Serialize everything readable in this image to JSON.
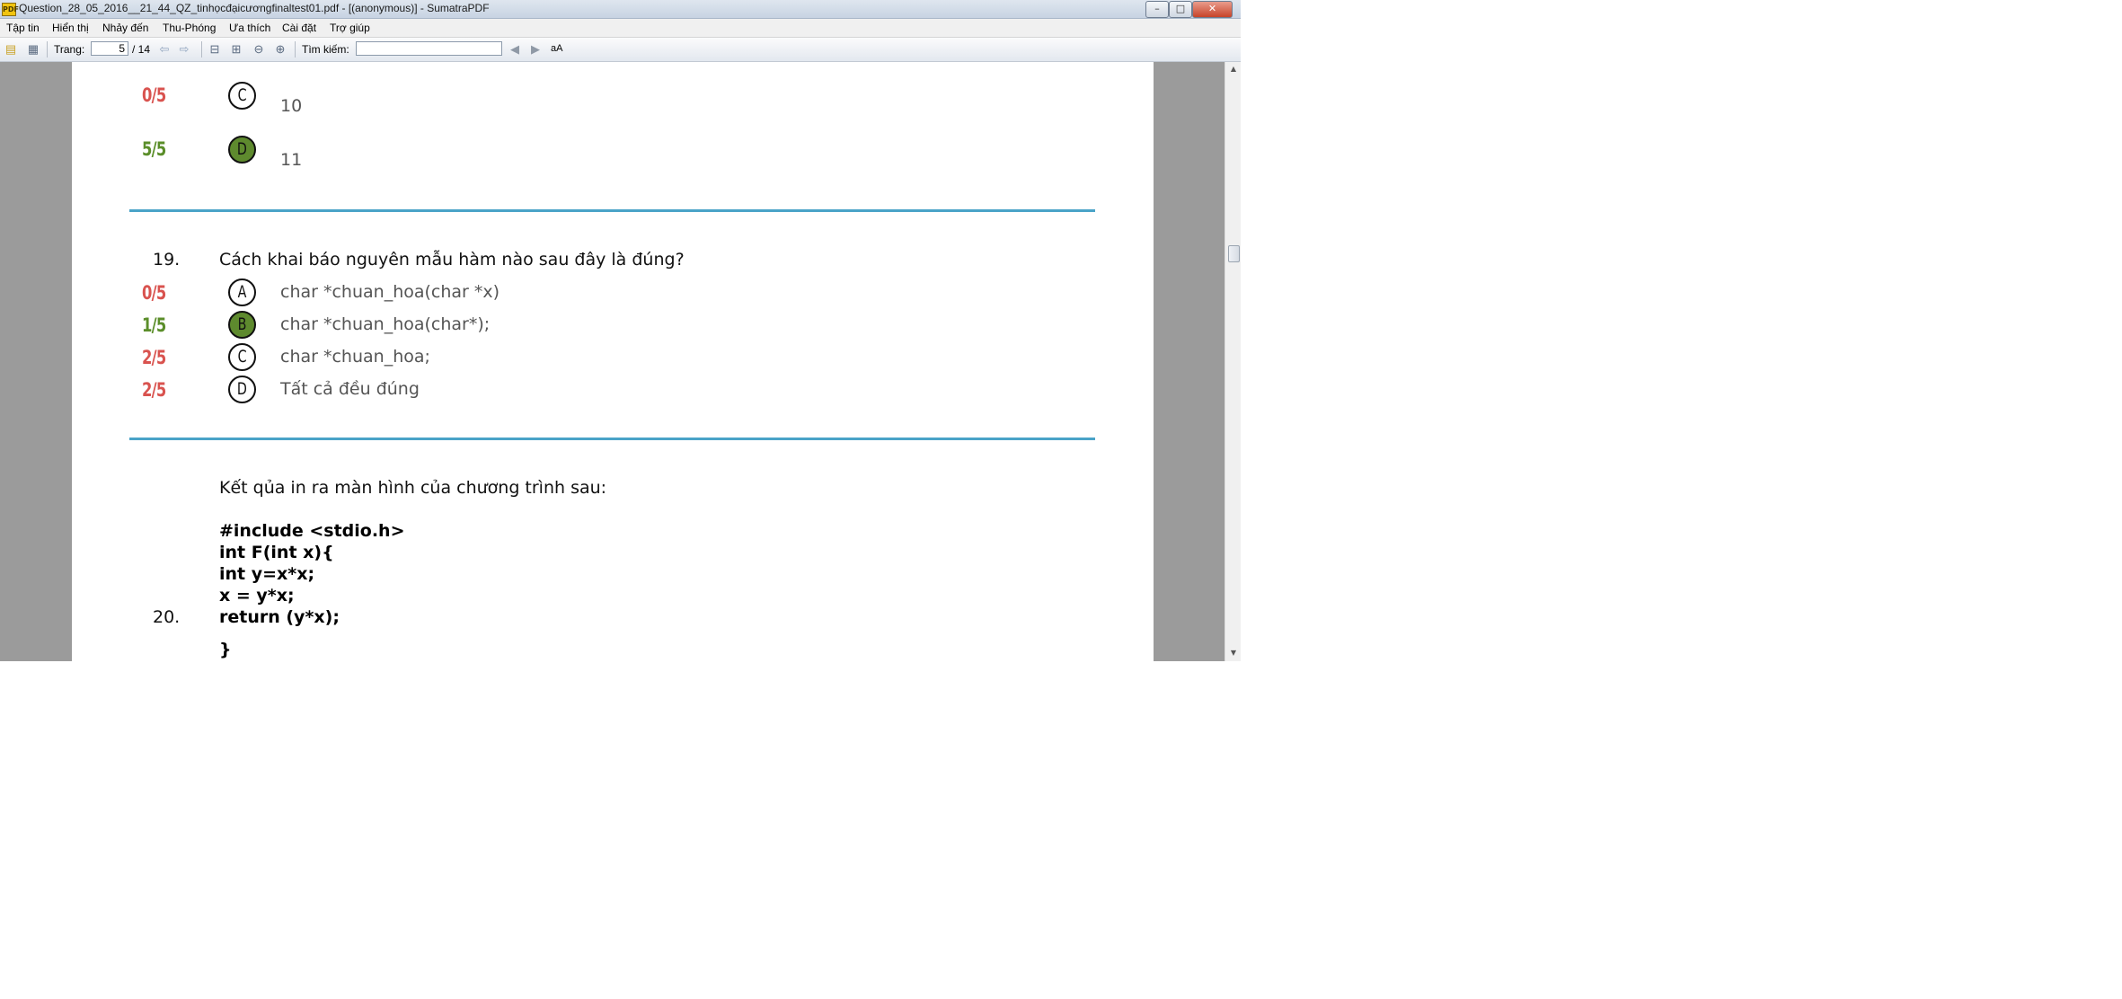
{
  "window": {
    "title": "Question_28_05_2016__21_44_QZ_tinhọcđạicươngfinaltest01.pdf - [(anonymous)] - SumatraPDF",
    "app_icon": "PDF",
    "controls": {
      "minimize": "–",
      "maximize": "□",
      "close": "✕"
    }
  },
  "menu": [
    "Tập tin",
    "Hiển thị",
    "Nhảy đến",
    "Thu-Phóng",
    "Ưa thích",
    "Cài đặt",
    "Trợ giúp"
  ],
  "toolbar": {
    "page_label": "Trang:",
    "page_value": "5",
    "page_total": "/ 14",
    "search_label": "Tìm kiếm:",
    "search_value": "",
    "match_case": "aA"
  },
  "icons": {
    "open": "folder-open-icon",
    "print": "printer-icon",
    "back": "arrow-left-icon",
    "forward": "arrow-right-icon",
    "fit_page": "fit-page-icon",
    "fit_width": "fit-width-icon",
    "zoom_out": "zoom-out-icon",
    "zoom_in": "zoom-in-icon",
    "find_prev": "find-previous-icon",
    "find_next": "find-next-icon"
  },
  "colors": {
    "correct": "#5b8e2a",
    "wrong": "#d9534f",
    "divider": "#4aa3c8",
    "filled_bubble": "#5e8a2e"
  },
  "document": {
    "prev_question": {
      "answers": [
        {
          "score": "0/5",
          "status": "wrong",
          "letter": "C",
          "text": "10",
          "selected": false
        },
        {
          "score": "5/5",
          "status": "correct",
          "letter": "D",
          "text": "11",
          "selected": true
        }
      ]
    },
    "q19": {
      "number": "19.",
      "text": "Cách khai báo nguyên mẫu hàm nào sau đây là đúng?",
      "answers": [
        {
          "score": "0/5",
          "status": "wrong",
          "letter": "A",
          "text": "char *chuan_hoa(char *x)",
          "selected": false
        },
        {
          "score": "1/5",
          "status": "correct",
          "letter": "B",
          "text": "char *chuan_hoa(char*);",
          "selected": true
        },
        {
          "score": "2/5",
          "status": "wrong",
          "letter": "C",
          "text": "char *chuan_hoa;",
          "selected": false
        },
        {
          "score": "2/5",
          "status": "wrong",
          "letter": "D",
          "text": "Tất cả đều đúng",
          "selected": false
        }
      ]
    },
    "q20": {
      "number": "20.",
      "text": "Kết qủa in ra màn hình của chương trình sau:",
      "code": [
        "#include <stdio.h>",
        "int F(int x){",
        "int y=x*x;",
        "x = y*x;",
        "return (y*x);",
        "}"
      ]
    }
  }
}
